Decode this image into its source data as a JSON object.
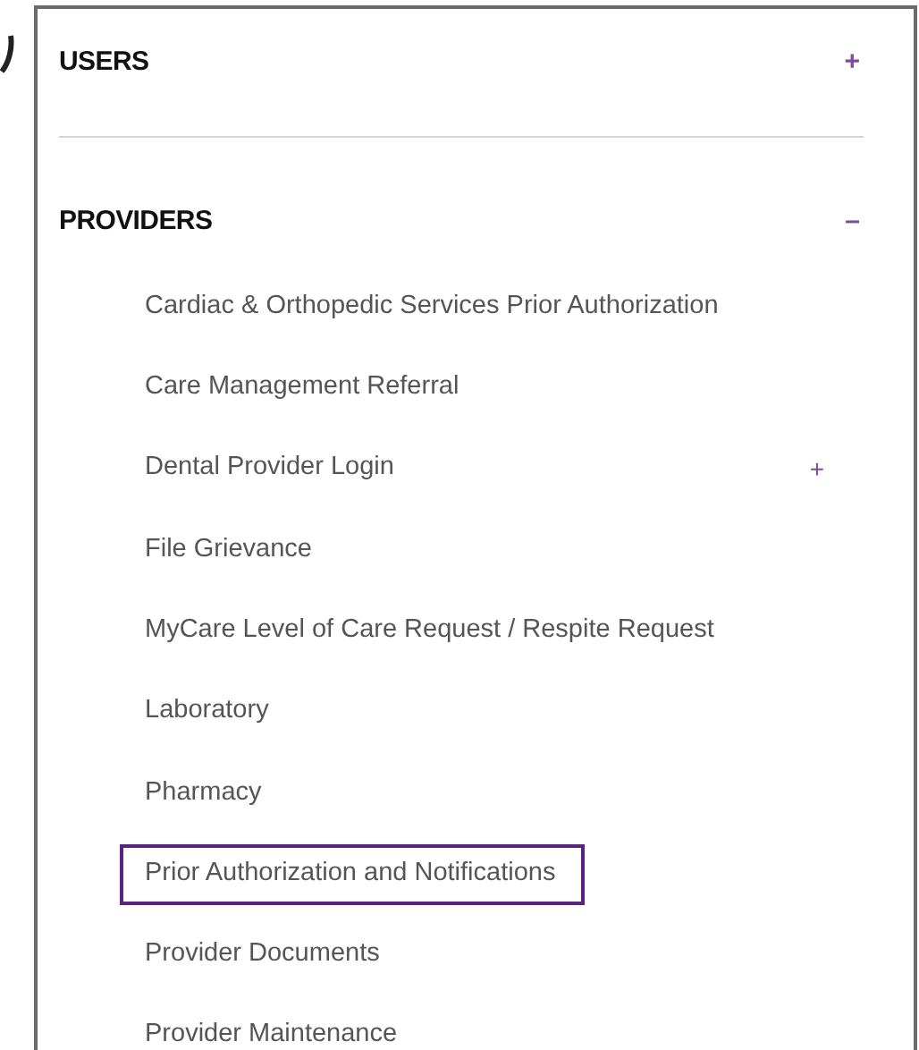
{
  "sections": [
    {
      "title": "USERS",
      "toggle": "+"
    },
    {
      "title": "PROVIDERS",
      "toggle": "–",
      "items": [
        {
          "label": "Cardiac & Orthopedic Services Prior Authorization",
          "selected": false
        },
        {
          "label": "Care Management Referral",
          "selected": false
        },
        {
          "label": "Dental Provider Login",
          "toggle": "+",
          "selected": false
        },
        {
          "label": "File Grievance",
          "selected": false
        },
        {
          "label": "MyCare Level of Care Request / Respite Request",
          "selected": false
        },
        {
          "label": "Laboratory",
          "selected": false
        },
        {
          "label": "Pharmacy",
          "selected": false
        },
        {
          "label": "Prior Authorization and Notifications",
          "selected": true
        },
        {
          "label": "Provider Documents",
          "selected": false
        },
        {
          "label": "Provider Maintenance",
          "selected": false
        }
      ]
    }
  ]
}
